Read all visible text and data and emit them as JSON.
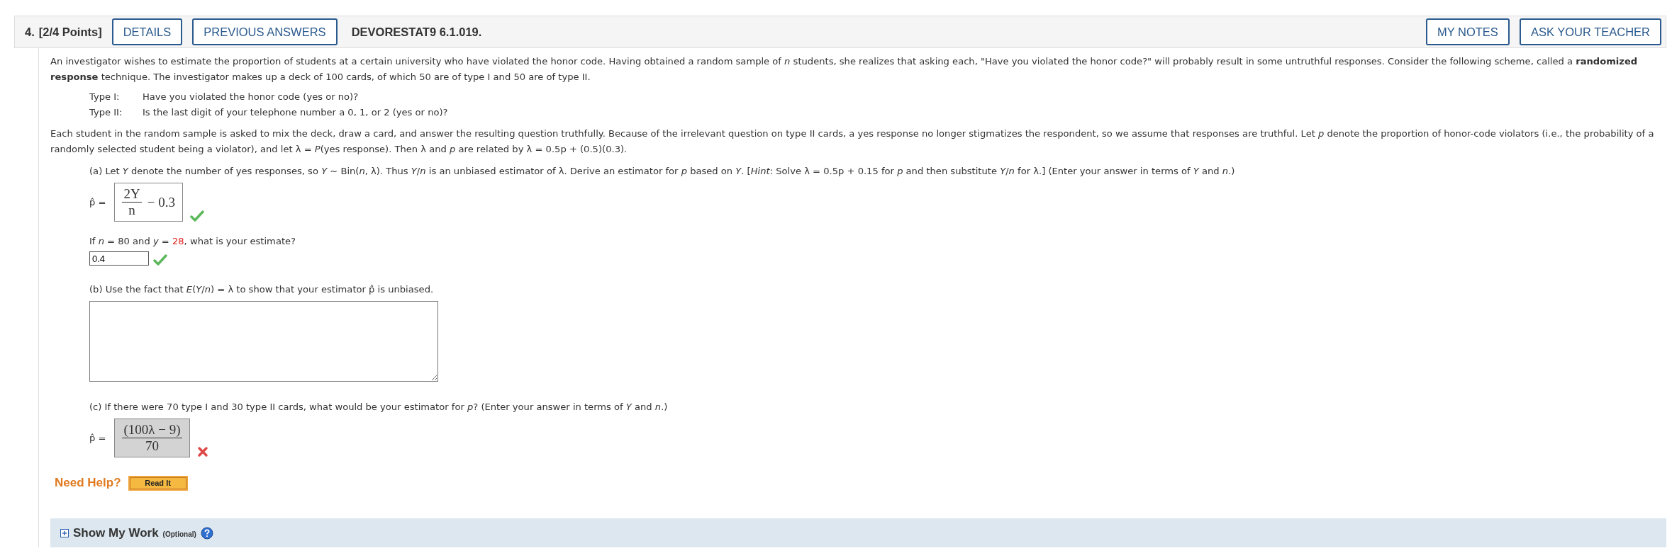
{
  "header": {
    "number": "4.",
    "points": "[2/4 Points]",
    "buttons_left": [
      "DETAILS",
      "PREVIOUS ANSWERS"
    ],
    "code": "DEVORESTAT9 6.1.019.",
    "buttons_right": [
      "MY NOTES",
      "ASK YOUR TEACHER"
    ]
  },
  "intro": "An investigator wishes to estimate the proportion of students at a certain university who have violated the honor code. Having obtained a random sample of *n* students, she realizes that asking each, \"Have you violated the honor code?\" will probably result in some untruthful responses. Consider the following scheme, called a **randomized response** technique. The investigator makes up a deck of 100 cards, of which 50 are of type I and 50 are of type II.",
  "types": [
    {
      "label": "Type I:",
      "question": "Have you violated the honor code (yes or no)?"
    },
    {
      "label": "Type II:",
      "question": "Is the last digit of your telephone number a 0, 1, or 2 (yes or no)?"
    }
  ],
  "setup": "Each student in the random sample is asked to mix the deck, draw a card, and answer the resulting question truthfully. Because of the irrelevant question on type II cards, a yes response no longer stigmatizes the respondent, so we assume that responses are truthful. Let *p* denote the proportion of honor-code violators (i.e., the probability of a randomly selected student being a violator), and let λ = *P*(yes response). Then λ and *p* are related by λ = 0.5p + (0.5)(0.3).",
  "parts": [
    {
      "kind": "formula",
      "prompt": "(a) Let *Y* denote the number of yes responses, so *Y* ~ Bin(*n*, λ). Thus *Y*/*n* is an unbiased estimator of λ. Derive an estimator for *p* based on *Y*. [*Hint*: Solve λ = 0.5p + 0.15 for *p* and then substitute *Y*/*n* for λ.] (Enter your answer in terms of *Y* and *n*.)",
      "lhs": "p̂ =",
      "numerator": "2Y",
      "denominator": "n",
      "tail": "− 0.3",
      "correct": true
    },
    {
      "kind": "number",
      "prompt_before": "If *n* = 80 and *y* = ",
      "highlight": "28",
      "prompt_after": ", what is your estimate?",
      "value": "0.4",
      "correct": true
    },
    {
      "kind": "essay",
      "prompt": "(b) Use the fact that *E*(*Y*/*n*) = λ to show that your estimator p̂ is unbiased."
    },
    {
      "kind": "formula",
      "prompt": "(c) If there were 70 type I and 30 type II cards, what would be your estimator for *p*? (Enter your answer in terms of *Y* and *n*.)",
      "lhs": "p̂ =",
      "numerator": "(100λ − 9)",
      "denominator": "70",
      "correct": false
    }
  ],
  "help": {
    "label": "Need Help?",
    "button": "Read It"
  },
  "show_work": {
    "title": "Show My Work",
    "note": "(Optional)",
    "expanded": false
  }
}
